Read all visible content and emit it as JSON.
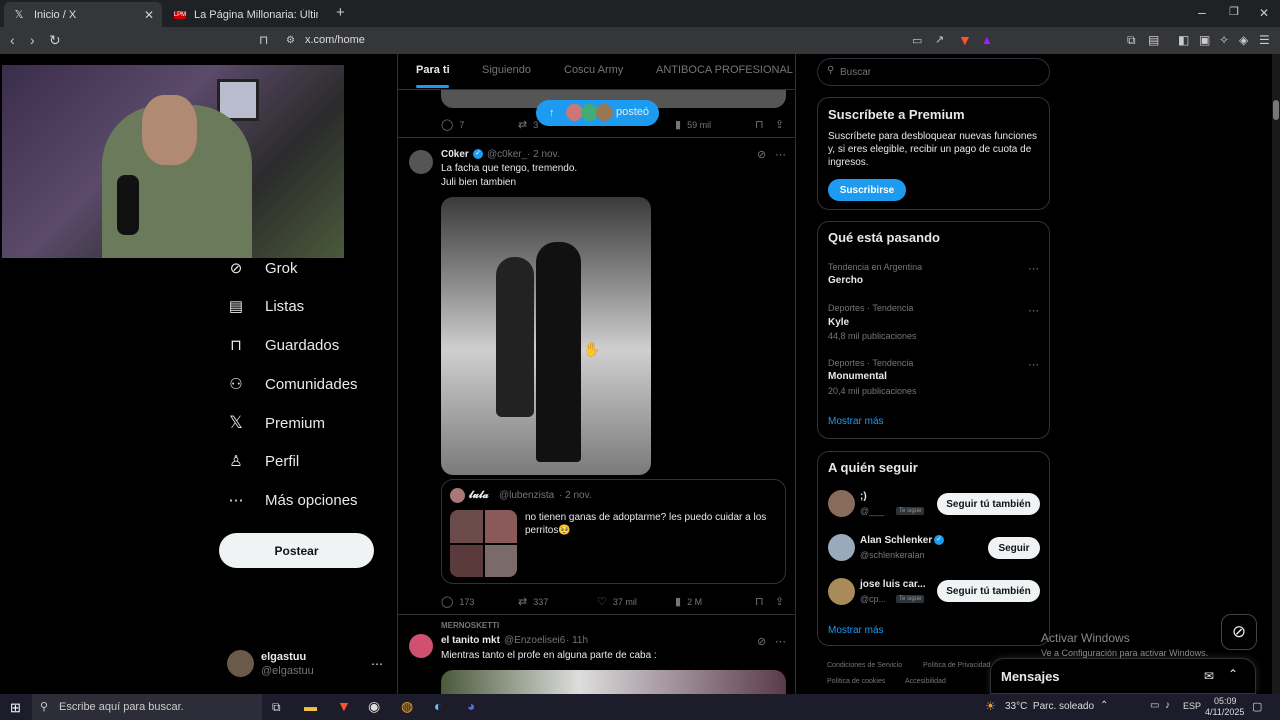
{
  "browser": {
    "tabs": [
      {
        "label": "Inicio / X",
        "active": true
      },
      {
        "label": "La Página Millonaria: Últimas noticias",
        "active": false
      }
    ],
    "url": "x.com/home"
  },
  "nav": {
    "items": [
      "Grok",
      "Listas",
      "Guardados",
      "Comunidades",
      "Premium",
      "Perfil",
      "Más opciones"
    ],
    "post_label": "Postear",
    "user": {
      "name": "elgastuu",
      "handle": "@elgastuu"
    }
  },
  "feed": {
    "tabs": [
      "Para ti",
      "Siguiendo",
      "Coscu Army",
      "ANTIBOCA PROFESIONAL"
    ],
    "new_posts_pill": "posteó",
    "prev_post_actions": {
      "replies": "7",
      "reposts": "3",
      "views": "59 mil"
    },
    "post1": {
      "author": "C0ker",
      "handle": "@c0ker_",
      "date": "· 2 nov.",
      "text1": "La facha que tengo, tremendo.",
      "text2": "Juli bien tambien",
      "quote": {
        "author": "𝓵𝓾𝓵𝓪",
        "handle": "@lubenzista",
        "date": "· 2 nov.",
        "text": "no tienen ganas de adoptarme? les puedo cuidar a los perritos🥺"
      },
      "actions": {
        "replies": "173",
        "reposts": "337",
        "likes": "37 mil",
        "views": "2 M"
      }
    },
    "post2": {
      "context": "MERNOSKETTI",
      "author": "el tanito mkt",
      "handle": "@Enzoelisei6",
      "date": "· 11h",
      "text": "Mientras tanto el profe en alguna parte de caba :"
    }
  },
  "sidebar": {
    "search_placeholder": "Buscar",
    "premium": {
      "title": "Suscríbete a Premium",
      "text": "Suscríbete para desbloquear nuevas funciones y, si eres elegible, recibir un pago de cuota de ingresos.",
      "button": "Suscribirse"
    },
    "trends": {
      "title": "Qué está pasando",
      "items": [
        {
          "meta": "Tendencia en Argentina",
          "name": "Gercho",
          "count": ""
        },
        {
          "meta": "Deportes · Tendencia",
          "name": "Kyle",
          "count": "44,8 mil publicaciones"
        },
        {
          "meta": "Deportes · Tendencia",
          "name": "Monumental",
          "count": "20,4 mil publicaciones"
        }
      ],
      "show_more": "Mostrar más"
    },
    "who_to_follow": {
      "title": "A quién seguir",
      "users": [
        {
          "name": ";)",
          "handle": "@___",
          "badge": "Te sigue",
          "button": "Seguir tú también"
        },
        {
          "name": "Alan Schlenker",
          "handle": "@schlenkeralan",
          "badge": "",
          "button": "Seguir"
        },
        {
          "name": "jose luis car...",
          "handle": "@cp...",
          "badge": "Te sigue",
          "button": "Seguir tú también"
        }
      ],
      "show_more": "Mostrar más"
    },
    "footer": [
      "Condiciones de Servicio",
      "Política de Privacidad",
      "Política de cookies",
      "Accesibilidad"
    ]
  },
  "messages": {
    "title": "Mensajes"
  },
  "windows_activation": {
    "title": "Activar Windows",
    "subtitle": "Ve a Configuración para activar Windows."
  },
  "taskbar": {
    "search_placeholder": "Escribe aquí para buscar.",
    "weather": "33°C  Parc. soleado",
    "lang": "ESP",
    "time": "05:09",
    "date": "4/11/2025"
  },
  "colors": {
    "accent": "#1d9bf0",
    "bg": "#000000",
    "border": "#2f3336"
  }
}
